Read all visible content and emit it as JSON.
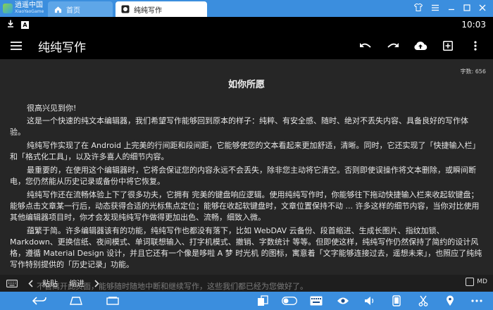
{
  "emulator": {
    "logo_name": "逍遥中国",
    "logo_sub": "XiaoYaoGame",
    "tabs": [
      {
        "label": "首页"
      },
      {
        "label": "纯纯写作"
      }
    ]
  },
  "status_bar": {
    "time": "10:03"
  },
  "toolbar": {
    "title": "纯纯写作"
  },
  "document": {
    "word_count": "字数: 656",
    "title": "如你所愿",
    "paragraphs": [
      "很高兴见到你!",
      "这是一个快速的纯文本编辑器，我们希望写作能够回到原本的样子：纯粹、有安全感、随时、绝对不丢失内容、具备良好的写作体验。",
      "纯纯写作实现了在 Android 上完美的行间距和段间距，它能够使您的文本看起来更加舒适，清晰。同时，它还实现了「快捷输入栏」和「格式化工具」，以及许多喜人的细节内容。",
      "最重要的，在使用这个编辑器时，它将会保证您的内容永远不会丢失，除非您主动将它清空。否则即使误操作将文本删除，或瞬间断电，您仍然能从历史记录或备份中将它恢复。",
      "纯纯写作还在流畅体验上下了很多功夫，它拥有 完美的键盘响应逻辑。使用纯纯写作时，你能够往下拖动快捷输入栏来收起软键盘；能够点击文章某一行后，动态获得合适的光标焦点定位；能够在收起软键盘时，文章位置保持不动 ... 许多这样的细节内容，当你对比使用其他编辑器项目时，你才会发现纯纯写作做得更加出色、流畅，细致入微。",
      "蕴繁于简。许多编辑器该有的功能，纯纯写作也都没有落下，比如 WebDAV 云备份、段首缩进、生成长图片、指纹加锁、Markdown、更换信纸、夜间模式、单词联想输入、打字机模式、撤销、字数统计 等等。但即使这样，纯纯写作仍然保持了简约的设计风格，遵循 Material Design 设计，并且它还有一个像是哆啦 A 梦 时光机 的图标，寓意着「文字能够连接过去，遥想未来」，也照应了纯纯写作特别提供的「历史记录」功能。"
    ],
    "hidden_line": "不管离开此页面，能够随时随地中断和继续写作，这些我们都已经为您做好了。"
  },
  "quickbar": {
    "paste_label": "粘贴",
    "indent_label": "缩进",
    "md_label": "MD"
  },
  "colors": {
    "emulator_blue": "#3b8ede",
    "editor_bg": "#262626",
    "toolbar_bg": "#000000"
  }
}
